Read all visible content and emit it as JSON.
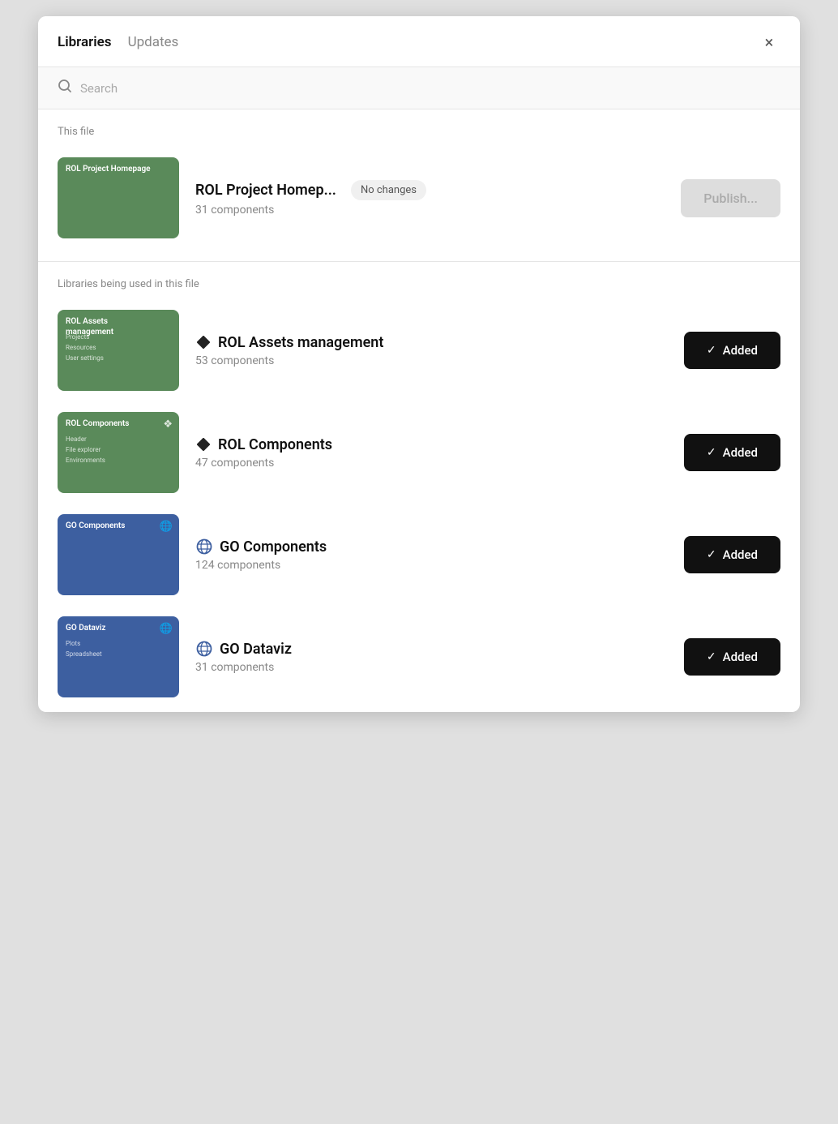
{
  "header": {
    "tab_libraries": "Libraries",
    "tab_updates": "Updates",
    "close_label": "×"
  },
  "search": {
    "placeholder": "Search"
  },
  "this_file": {
    "section_title": "This file",
    "items": [
      {
        "thumbnail_label": "ROL Project Homepage",
        "name": "ROL Project Homep...",
        "count": "31 components",
        "badge": "No changes",
        "action": "Publish...",
        "action_disabled": true,
        "type": "local"
      }
    ]
  },
  "libraries_used": {
    "section_title": "Libraries being used in this file",
    "items": [
      {
        "thumbnail_label": "ROL Assets management",
        "thumbnail_sublabel": "Projects\nResources\nUser settings",
        "name": "ROL Assets management",
        "count": "53 components",
        "action": "Added",
        "type": "local",
        "color": "green"
      },
      {
        "thumbnail_label": "ROL Components",
        "thumbnail_sublabel": "Header\nFile explorer\nEnvironments",
        "thumbnail_badge": "❖",
        "name": "ROL Components",
        "count": "47 components",
        "action": "Added",
        "type": "local",
        "color": "green"
      },
      {
        "thumbnail_label": "GO Components",
        "thumbnail_badge": "🌐",
        "name": "GO Components",
        "count": "124 components",
        "action": "Added",
        "type": "global",
        "color": "blue"
      },
      {
        "thumbnail_label": "GO Dataviz",
        "thumbnail_sublabel": "Plots\nSpreadsheet",
        "thumbnail_badge": "🌐",
        "name": "GO Dataviz",
        "count": "31 components",
        "action": "Added",
        "type": "global",
        "color": "blue"
      }
    ]
  },
  "icons": {
    "search": "🔍",
    "check": "✓",
    "diamond": "❖",
    "globe": "🌐"
  }
}
